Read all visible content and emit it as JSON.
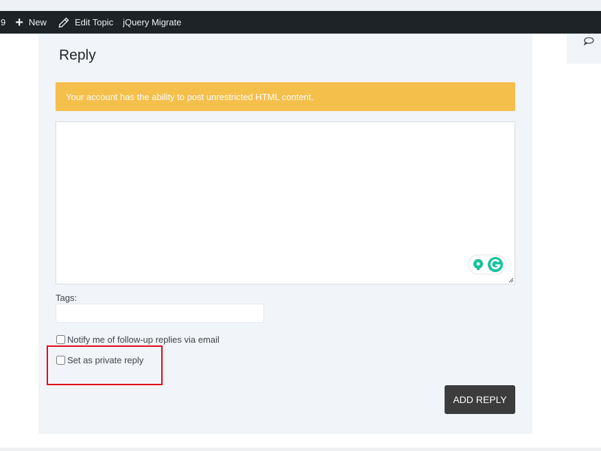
{
  "admin_bar": {
    "count_text": "9",
    "new_label": "New",
    "edit_label": "Edit Topic",
    "plugin_label": "jQuery Migrate"
  },
  "reply": {
    "title": "Reply",
    "notice": "Your account has the ability to post unrestricted HTML content.",
    "editor_value": "",
    "tags_label": "Tags:",
    "tags_value": "",
    "notify_label": "Notify me of follow-up replies via email",
    "notify_checked": false,
    "private_label": "Set as private reply",
    "private_checked": false,
    "submit_label": "ADD REPLY"
  },
  "colors": {
    "admin_bar_bg": "#1d2327",
    "notice_bg": "#f5bf4b",
    "card_bg": "#f1f4f8",
    "submit_bg": "#3c3c3d",
    "highlight": "#e30613",
    "grammarly_green": "#15c39a"
  }
}
